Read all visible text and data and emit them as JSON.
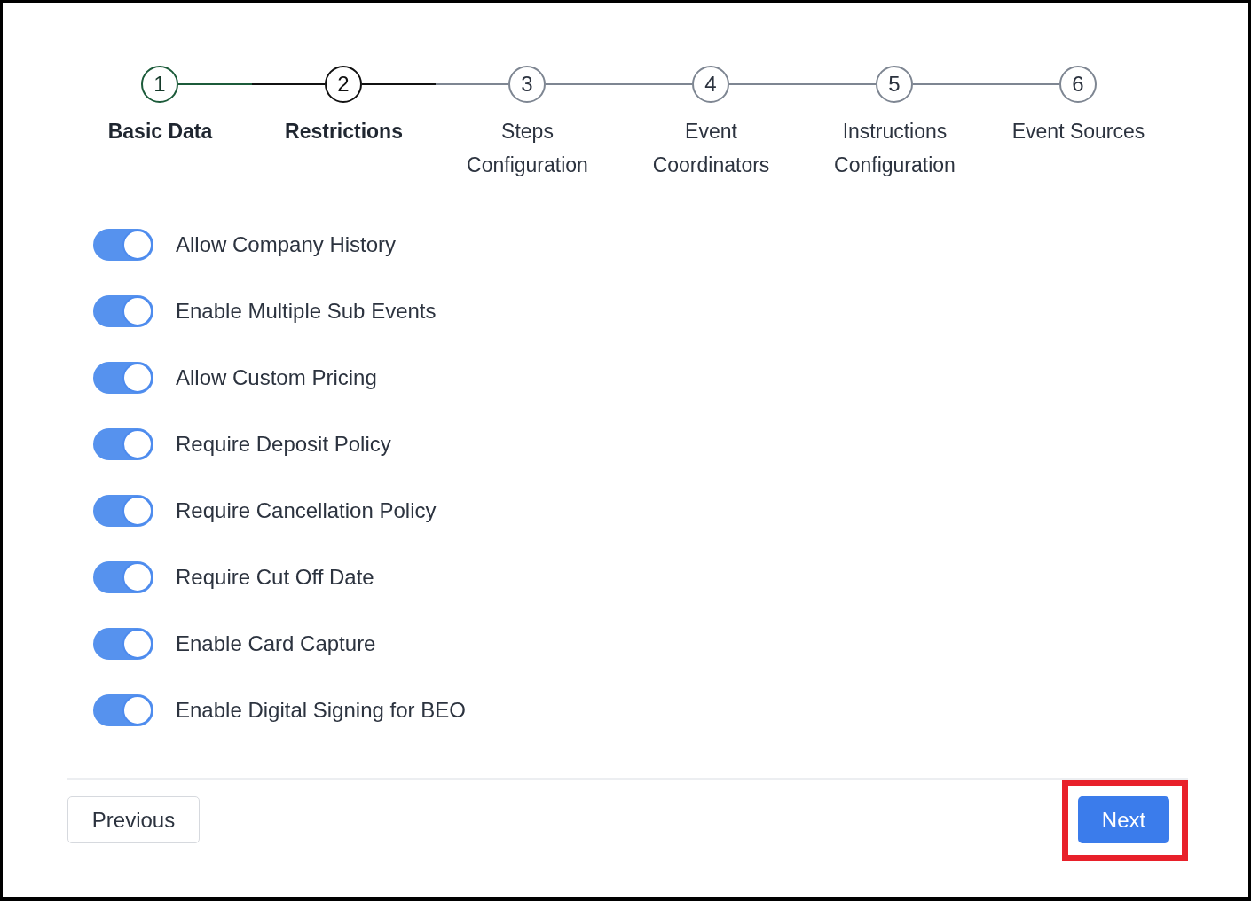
{
  "stepper": {
    "steps": [
      {
        "number": "1",
        "label": "Basic Data",
        "completed": true,
        "selected": false
      },
      {
        "number": "2",
        "label": "Restrictions",
        "completed": false,
        "selected": true
      },
      {
        "number": "3",
        "label": "Steps Configuration",
        "completed": false,
        "selected": false
      },
      {
        "number": "4",
        "label": "Event Coordinators",
        "completed": false,
        "selected": false
      },
      {
        "number": "5",
        "label": "Instructions Configuration",
        "completed": false,
        "selected": false
      },
      {
        "number": "6",
        "label": "Event Sources",
        "completed": false,
        "selected": false
      }
    ]
  },
  "settings": [
    {
      "label": "Allow Company History",
      "on": true
    },
    {
      "label": "Enable Multiple Sub Events",
      "on": true
    },
    {
      "label": "Allow Custom Pricing",
      "on": true
    },
    {
      "label": "Require Deposit Policy",
      "on": true
    },
    {
      "label": "Require Cancellation Policy",
      "on": true
    },
    {
      "label": "Require Cut Off Date",
      "on": true
    },
    {
      "label": "Enable Card Capture",
      "on": true
    },
    {
      "label": "Enable Digital Signing for BEO",
      "on": true
    }
  ],
  "footer": {
    "previous_button": {
      "label": "Previous"
    },
    "next_button": {
      "label": "Next",
      "highlighted": true
    }
  }
}
